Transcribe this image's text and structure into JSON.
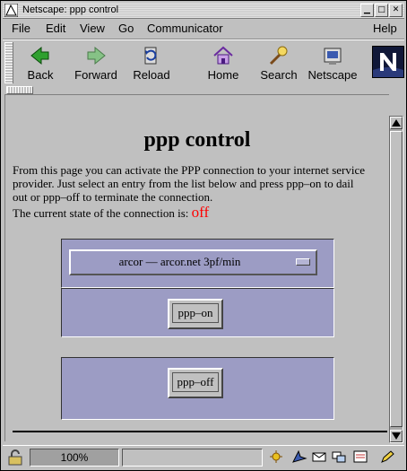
{
  "window": {
    "title": "Netscape: ppp control"
  },
  "menubar": {
    "file": "File",
    "edit": "Edit",
    "view": "View",
    "go": "Go",
    "communicator": "Communicator",
    "help": "Help"
  },
  "toolbar": {
    "back": "Back",
    "forward": "Forward",
    "reload": "Reload",
    "home": "Home",
    "search": "Search",
    "netscape": "Netscape"
  },
  "page": {
    "title": "ppp control",
    "intro": "From this page you can activate the PPP connection to your internet service provider. Just select an entry from the list below and press ppp–on to dail out or ppp–off to terminate the connection.",
    "state_label": "The current state of the connection is:",
    "state_value": "off",
    "select_value": "arcor –– arcor.net 3pf/min",
    "ppp_on_label": "ppp–on",
    "ppp_off_label": "ppp–off"
  },
  "statusbar": {
    "zoom": "100%"
  },
  "colors": {
    "state_off": "#ff0000",
    "cell_bg": "#9c9cc4",
    "window_bg": "#c0c0c0"
  }
}
